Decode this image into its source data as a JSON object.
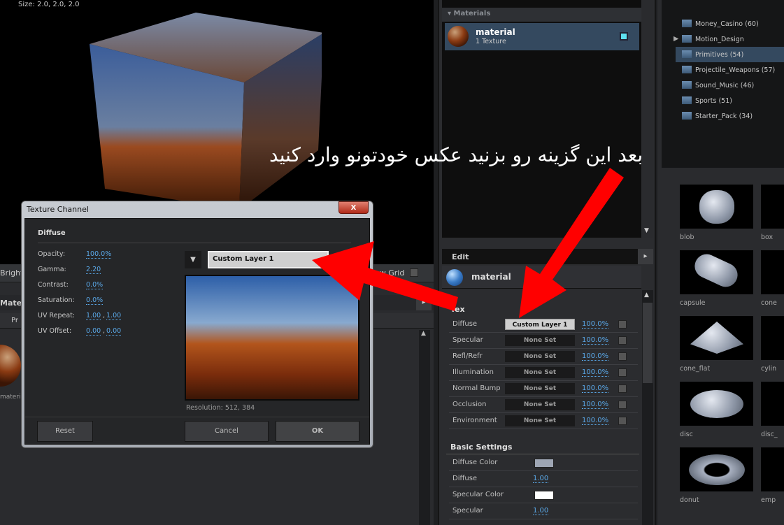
{
  "viewport": {
    "size_label": "Size: 2.0, 2.0, 2.0",
    "toolbar_left": "Brightn",
    "toolbar_right": "ow Grid",
    "materials_tab": "Mate",
    "tab_pr": "Pr",
    "thumb_label": "materia"
  },
  "materials_panel": {
    "header": "Materials",
    "item_name": "material",
    "item_sub": "1 Texture"
  },
  "edit_panel": {
    "header": "Edit",
    "material_name": "material",
    "textures_section": "Tex",
    "channels": [
      {
        "label": "Diffuse",
        "slot": "Custom Layer 1",
        "pct": "100.0%",
        "active": true
      },
      {
        "label": "Specular",
        "slot": "None Set",
        "pct": "100.0%"
      },
      {
        "label": "Refl/Refr",
        "slot": "None Set",
        "pct": "100.0%"
      },
      {
        "label": "Illumination",
        "slot": "None Set",
        "pct": "100.0%"
      },
      {
        "label": "Normal Bump",
        "slot": "None Set",
        "pct": "100.0%"
      },
      {
        "label": "Occlusion",
        "slot": "None Set",
        "pct": "100.0%"
      },
      {
        "label": "Environment",
        "slot": "None Set",
        "pct": "100.0%"
      }
    ],
    "basic_settings": "Basic Settings",
    "basic": [
      {
        "label": "Diffuse Color",
        "color": "#9ea6b4"
      },
      {
        "label": "Diffuse",
        "value": "1.00"
      },
      {
        "label": "Specular Color",
        "color": "#ffffff"
      },
      {
        "label": "Specular",
        "value": "1.00"
      }
    ]
  },
  "tree": [
    {
      "label": "Money_Casino (60)"
    },
    {
      "label": "Motion_Design",
      "expandable": true
    },
    {
      "label": "Primitives (54)",
      "selected": true
    },
    {
      "label": "Projectile_Weapons (57)"
    },
    {
      "label": "Sound_Music (46)"
    },
    {
      "label": "Sports (51)"
    },
    {
      "label": "Starter_Pack (34)"
    }
  ],
  "thumbnails": [
    {
      "label": "blob"
    },
    {
      "label": "box"
    },
    {
      "label": "capsule"
    },
    {
      "label": "cone"
    },
    {
      "label": "cone_flat"
    },
    {
      "label": "cylin"
    },
    {
      "label": "disc"
    },
    {
      "label": "disc_"
    },
    {
      "label": "donut"
    },
    {
      "label": "emp"
    }
  ],
  "dialog": {
    "title": "Texture Channel",
    "close": "X",
    "section": "Diffuse",
    "fields": [
      {
        "label": "Opacity:",
        "values": [
          "100.0%"
        ]
      },
      {
        "label": "Gamma:",
        "values": [
          "2.20"
        ]
      },
      {
        "label": "Contrast:",
        "values": [
          "0.0%"
        ]
      },
      {
        "label": "Saturation:",
        "values": [
          "0.0%"
        ]
      },
      {
        "label": "UV Repeat:",
        "values": [
          "1.00",
          "1.00"
        ]
      },
      {
        "label": "UV Offset:",
        "values": [
          "0.00",
          "0.00"
        ]
      }
    ],
    "layer": "Custom Layer 1",
    "resolution": "Resolution: 512, 384",
    "reset": "Reset",
    "cancel": "Cancel",
    "ok": "OK"
  },
  "annotation": {
    "text": "بعد این گزینه رو بزنید عکس خودتونو وارد کنید",
    "arrow_color": "#ff0000"
  },
  "colors": {
    "selection": "#34495f",
    "link": "#5aa8e8"
  }
}
